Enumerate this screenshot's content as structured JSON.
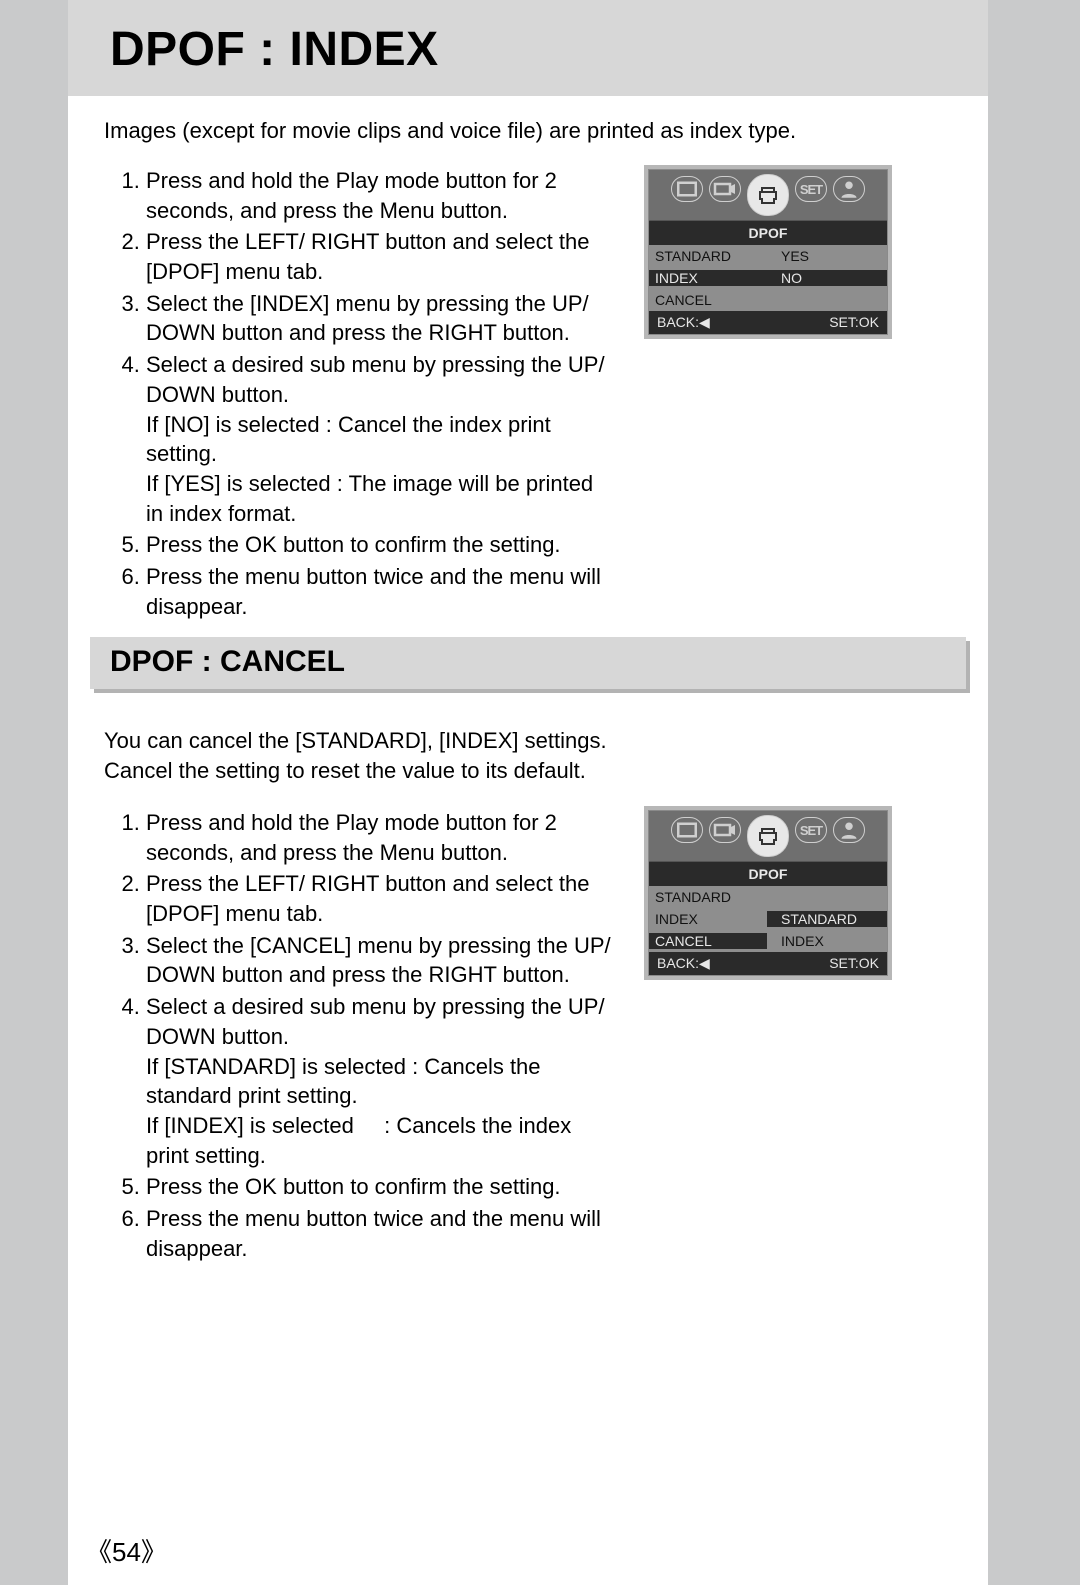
{
  "page_number_display": "《54》",
  "section1": {
    "title": "DPOF : INDEX",
    "intro": "Images (except for movie clips and voice file) are printed as index type.",
    "steps": [
      "Press and hold the Play mode button for 2 seconds, and press the Menu button.",
      "Press the LEFT/ RIGHT button and select the [DPOF] menu tab.",
      "Select the [INDEX] menu by pressing the UP/ DOWN button and press the RIGHT button.",
      "Select a desired sub menu by pressing the UP/ DOWN button.",
      "Press the OK button to confirm the setting.",
      "Press the menu button twice and the menu will disappear."
    ],
    "sub_after_step4": [
      {
        "label": "If [NO] is selected",
        "desc": ": Cancel the index print setting."
      },
      {
        "label": "If [YES] is selected",
        "desc": ": The image will be printed in index format."
      }
    ],
    "lcd": {
      "title": "DPOF",
      "rows": [
        {
          "left": "STANDARD",
          "right": "YES",
          "hi_left": false,
          "hi_right": false
        },
        {
          "left": "INDEX",
          "right": "NO",
          "hi_left": true,
          "hi_right": true
        },
        {
          "left": "CANCEL",
          "right": "",
          "hi_left": false,
          "hi_right": false
        }
      ],
      "foot_left": "BACK:◀",
      "foot_right": "SET:OK",
      "set_label": "SET"
    }
  },
  "section2": {
    "title": "DPOF : CANCEL",
    "intro_line1": "You can cancel the [STANDARD], [INDEX] settings.",
    "intro_line2": "Cancel the setting to reset the value to its default.",
    "steps": [
      "Press and hold the Play mode button for 2 seconds, and press the Menu button.",
      "Press the LEFT/ RIGHT button and select the [DPOF] menu tab.",
      "Select the [CANCEL] menu by pressing the UP/ DOWN button and press the RIGHT button.",
      "Select a desired sub menu by pressing the UP/ DOWN button.",
      "Press the OK button to confirm the setting.",
      "Press the menu button twice and the menu will disappear."
    ],
    "sub_after_step4": [
      {
        "label": "If [STANDARD] is selected",
        "desc": ": Cancels the standard print setting."
      },
      {
        "label": "If [INDEX] is selected",
        "desc": ": Cancels the index print setting."
      }
    ],
    "lcd": {
      "title": "DPOF",
      "rows": [
        {
          "left": "STANDARD",
          "right": "",
          "hi_left": false,
          "hi_right": false
        },
        {
          "left": "INDEX",
          "right": "STANDARD",
          "hi_left": false,
          "hi_right": true
        },
        {
          "left": "CANCEL",
          "right": "INDEX",
          "hi_left": true,
          "hi_right": false
        }
      ],
      "foot_left": "BACK:◀",
      "foot_right": "SET:OK",
      "set_label": "SET"
    }
  }
}
